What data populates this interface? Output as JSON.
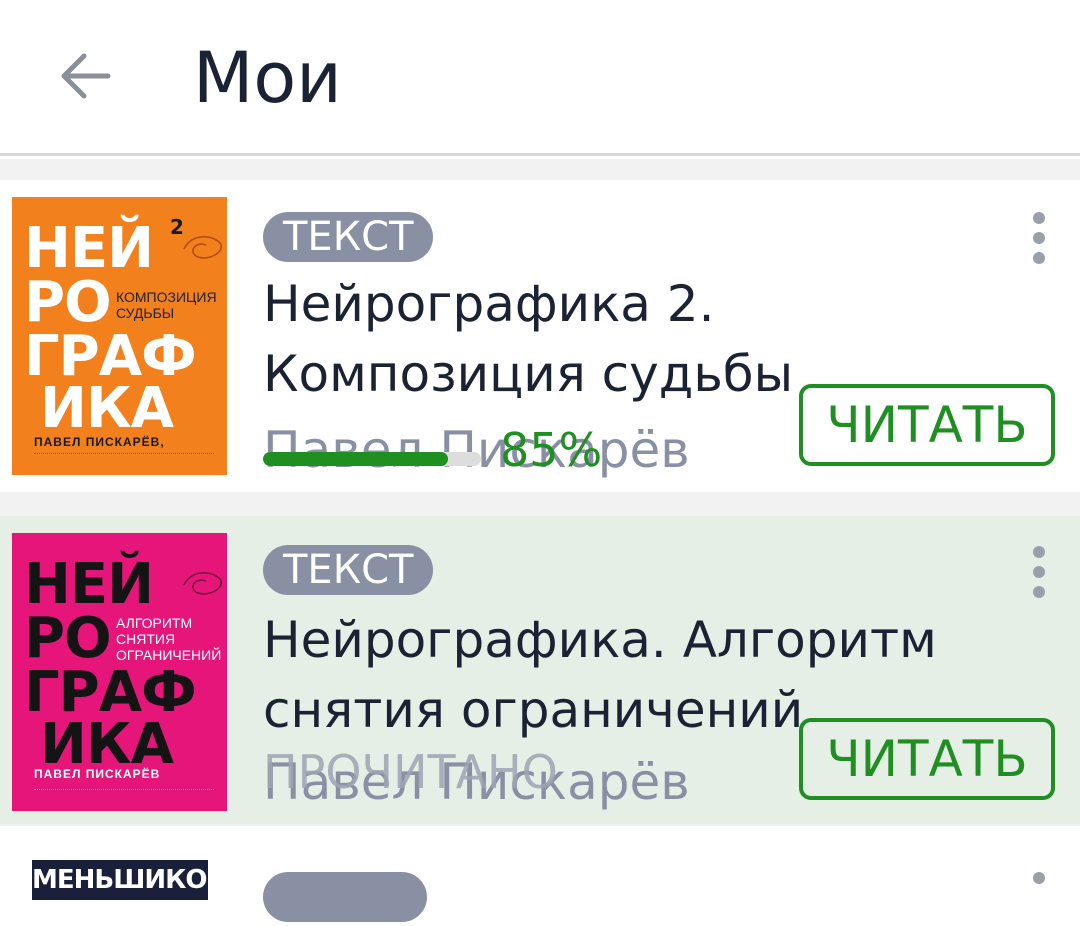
{
  "header": {
    "title": "Мои",
    "back_icon": "arrow-left-icon"
  },
  "items": [
    {
      "badge": "ТЕКСТ",
      "title": "Нейрографика 2. Композиция судьбы",
      "author": "Павел Пискарёв",
      "progress_percent": 85,
      "progress_label": "85%",
      "button": "ЧИТАТЬ",
      "cover": {
        "line1": "НЕЙ",
        "line2": "РО",
        "line3": "ГРАФ",
        "line4": "ИКА",
        "superscript": "2",
        "subtitle": "Композиция судьбы",
        "author": "ПАВЕЛ ПИСКАРЁВ,"
      },
      "colors": {
        "cover": "#f2811d",
        "accent": "#1f8f22"
      }
    },
    {
      "badge": "ТЕКСТ",
      "title": "Нейрографика. Алгоритм снятия ограничений",
      "author": "Павел Пискарёв",
      "status": "ПРОЧИТАНО",
      "button": "ЧИТАТЬ",
      "cover": {
        "line1": "НЕЙ",
        "line2": "РО",
        "line3": "ГРАФ",
        "line4": "ИКА",
        "subtitle": "Алгоритм снятия ограничений",
        "author": "ПАВЕЛ ПИСКАРЁВ"
      },
      "colors": {
        "cover": "#e5157a",
        "highlight": "#e5efe6"
      }
    },
    {
      "cover": {
        "text": "МЕНЬШИКОВА"
      }
    }
  ]
}
